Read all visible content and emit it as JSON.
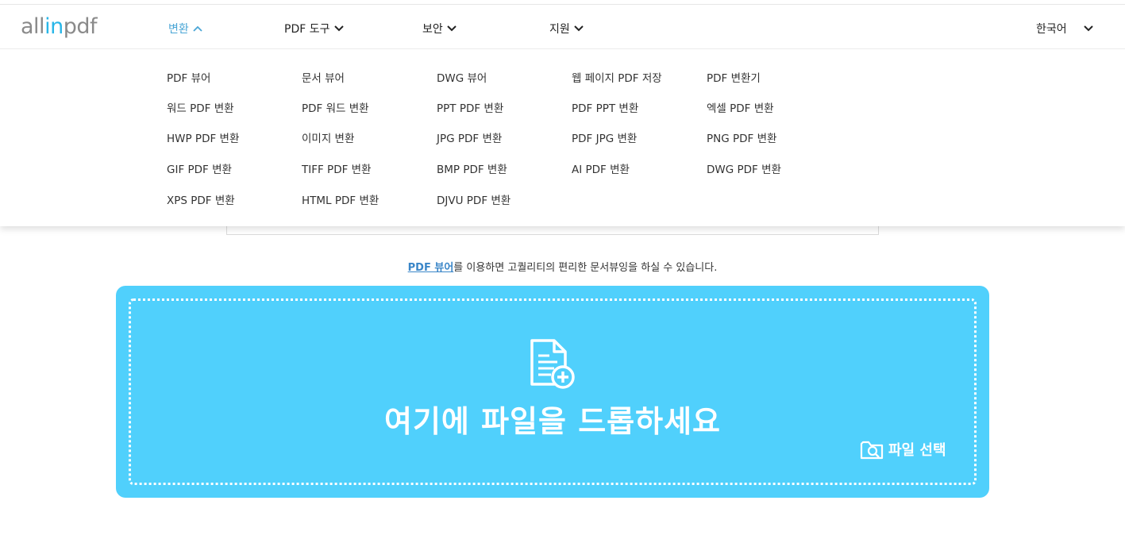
{
  "logo": {
    "part1": "all",
    "part2": "in",
    "part3": "pdf"
  },
  "nav": {
    "items": [
      {
        "label": "변환"
      },
      {
        "label": "PDF 도구"
      },
      {
        "label": "보안"
      },
      {
        "label": "지원"
      }
    ],
    "language": "한국어"
  },
  "menu": {
    "columns": [
      [
        "PDF 뷰어",
        "워드 PDF 변환",
        "HWP PDF 변환",
        "GIF PDF 변환",
        "XPS PDF 변환"
      ],
      [
        "문서 뷰어",
        "PDF 워드 변환",
        "이미지 변환",
        "TIFF PDF 변환",
        "HTML PDF 변환"
      ],
      [
        "DWG 뷰어",
        "PPT PDF 변환",
        "JPG PDF 변환",
        "BMP PDF 변환",
        "DJVU PDF 변환"
      ],
      [
        "웹 페이지 PDF 저장",
        "PDF PPT 변환",
        "PDF JPG 변환",
        "AI PDF 변환"
      ],
      [
        "PDF 변환기",
        "엑셀 PDF 변환",
        "PNG PDF 변환",
        "DWG PDF 변환"
      ]
    ]
  },
  "description": {
    "link": "PDF 뷰어",
    "text": "를 이용하면 고퀄리티의 편리한 문서뷰잉을 하실 수 있습니다."
  },
  "dropzone": {
    "title": "여기에 파일을 드롭하세요",
    "select_label": "파일 선택"
  },
  "colors": {
    "accent": "#50d0fc",
    "link": "#3a86c8",
    "logo_gray": "#8a8a8a",
    "logo_blue": "#29b6e8"
  }
}
